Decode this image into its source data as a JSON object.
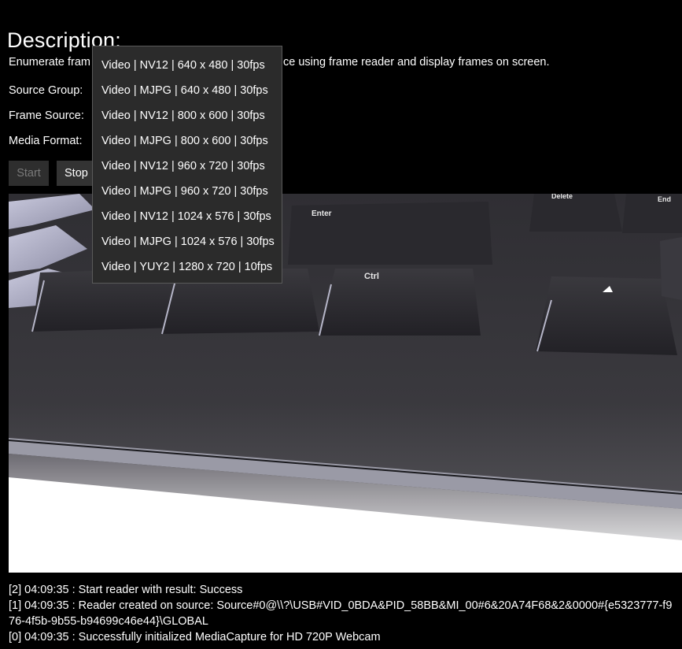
{
  "heading": "Description:",
  "description": {
    "visible_left": "Enumerate fram",
    "visible_right": "ce using frame reader and display frames on screen."
  },
  "labels": {
    "source_group": "Source Group:",
    "frame_source": "Frame Source:",
    "media_format": "Media Format:"
  },
  "buttons": {
    "start": {
      "label": "Start",
      "enabled": false
    },
    "stop": {
      "label": "Stop",
      "enabled": true
    }
  },
  "media_format_dropdown": {
    "open": true,
    "options": [
      "Video | NV12 | 640 x 480 | 30fps",
      "Video | MJPG | 640 x 480 | 30fps",
      "Video | NV12 | 800 x 600 | 30fps",
      "Video | MJPG | 800 x 600 | 30fps",
      "Video | NV12 | 960 x 720 | 30fps",
      "Video | MJPG | 960 x 720 | 30fps",
      "Video | NV12 | 1024 x 576 | 30fps",
      "Video | MJPG | 1024 x 576 | 30fps",
      "Video | YUY2 | 1280 x 720 | 10fps"
    ]
  },
  "preview": {
    "description": "live camera frame of a black keyboard",
    "key_labels": [
      "Enter",
      "Ctrl",
      "Delete",
      "End"
    ]
  },
  "log": [
    "[2] 04:09:35 : Start reader with result: Success",
    "[1] 04:09:35 : Reader created on source: Source#0@\\\\?\\USB#VID_0BDA&PID_58BB&MI_00#6&20A74F68&2&0000#{e5323777-f976-4f5b-9b55-b94699c46e44}\\GLOBAL",
    "[0] 04:09:35 : Successfully initialized MediaCapture for HD 720P Webcam"
  ],
  "colors": {
    "background": "#000000",
    "button_bg": "#333333",
    "dropdown_bg": "#2b2b2b",
    "dropdown_border": "#5a5a5a",
    "disabled_text": "#7a7a7a"
  }
}
